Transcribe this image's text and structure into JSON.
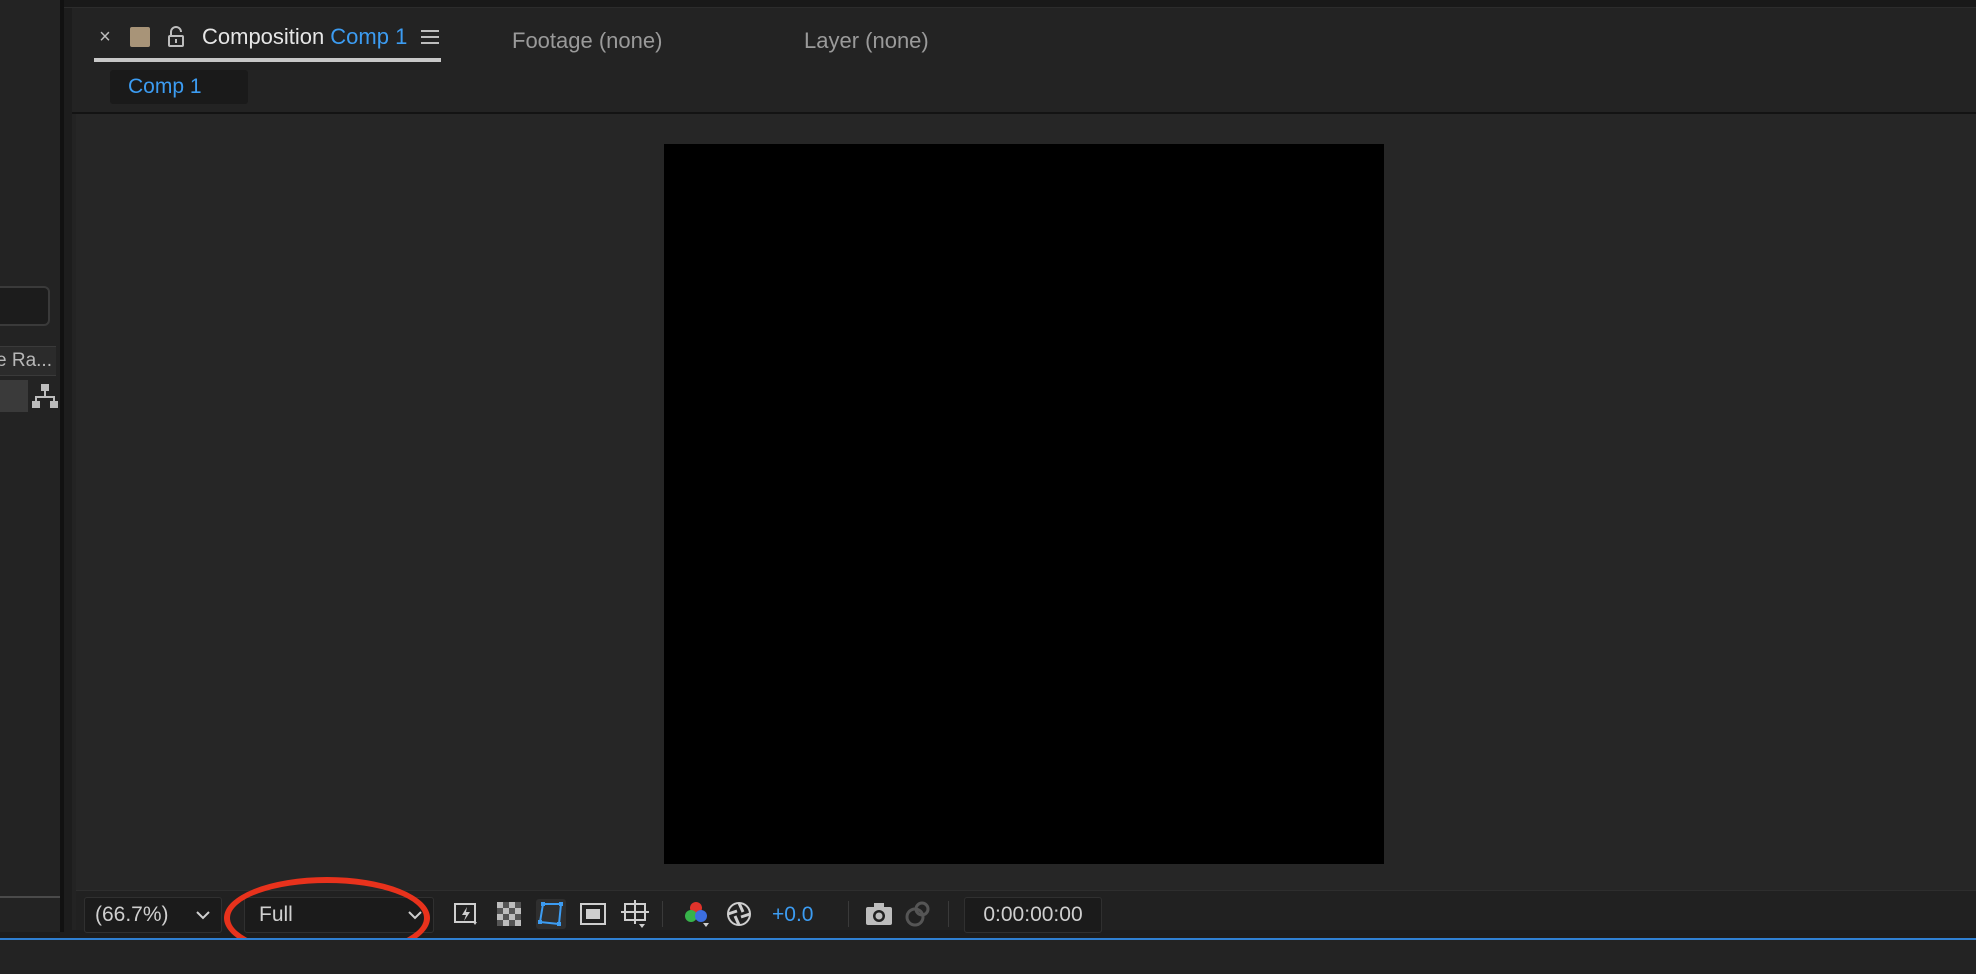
{
  "left_panel": {
    "column_header": "Frame Ra..."
  },
  "comp_panel": {
    "tabs": {
      "composition_label": "Composition",
      "composition_name": "Comp 1",
      "footage_label": "Footage (none)",
      "layer_label": "Layer (none)"
    },
    "breadcrumb": "Comp 1"
  },
  "toolbar": {
    "zoom": "(66.7%)",
    "resolution": "Full",
    "exposure": "+0.0",
    "timecode": "0:00:00:00"
  },
  "colors": {
    "accent_blue": "#3c9cf2",
    "highlight_red": "#e8321c",
    "comp_swatch": "#a89478"
  },
  "icons": [
    "flowchart-icon",
    "close-icon",
    "label-swatch-icon",
    "lock-icon",
    "panel-menu-icon",
    "chevron-down-icon",
    "fast-previews-icon",
    "transparency-grid-icon",
    "mask-visibility-icon",
    "region-of-interest-icon",
    "grid-guides-icon",
    "color-channels-icon",
    "reset-exposure-icon",
    "snapshot-icon",
    "show-snapshot-icon"
  ]
}
